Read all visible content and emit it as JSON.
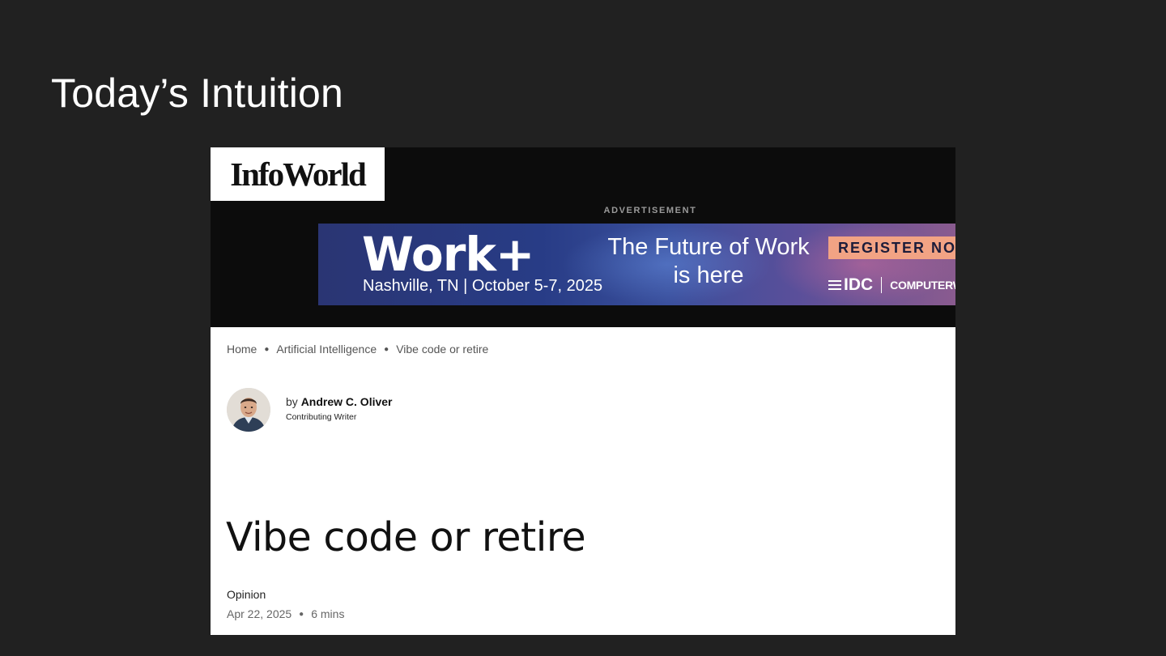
{
  "slide": {
    "title": "Today’s Intuition"
  },
  "site": {
    "logo": "InfoWorld"
  },
  "advertisement": {
    "label": "ADVERTISEMENT",
    "headline": "Work+",
    "location": "Nashville, TN | October 5-7, 2025",
    "tagline_line1": "The Future of Work",
    "tagline_line2": "is here",
    "cta": "REGISTER NOW",
    "sponsor1": "IDC",
    "sponsor2": "COMPUTERWORLD"
  },
  "breadcrumb": {
    "items": [
      "Home",
      "Artificial Intelligence",
      "Vibe code or retire"
    ]
  },
  "author": {
    "prefix": "by",
    "name": "Andrew C. Oliver",
    "role": "Contributing Writer"
  },
  "article": {
    "title": "Vibe code or retire",
    "type": "Opinion",
    "date": "Apr 22, 2025",
    "read_time": "6 mins"
  },
  "colors": {
    "slide_background": "#212121",
    "header_background": "#0c0c0c",
    "cta_background": "#f2a384"
  },
  "icons": [
    "author-avatar-photo"
  ]
}
